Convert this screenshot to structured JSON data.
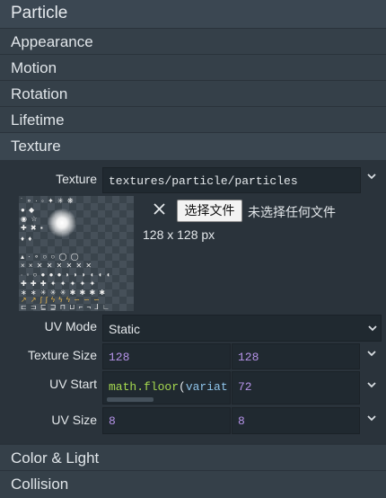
{
  "panel": {
    "title": "Particle"
  },
  "sections": {
    "appearance": "Appearance",
    "motion": "Motion",
    "rotation": "Rotation",
    "lifetime": "Lifetime",
    "texture": "Texture",
    "color_light": "Color & Light",
    "collision": "Collision"
  },
  "texture": {
    "label": "Texture",
    "path": "textures/particle/particles",
    "file_button": "选择文件",
    "no_file": "未选择任何文件",
    "dimensions": "128 x 128 px",
    "close_glyph": "✕"
  },
  "uv_mode": {
    "label": "UV Mode",
    "value": "Static"
  },
  "texture_size": {
    "label": "Texture Size",
    "x": "128",
    "y": "128"
  },
  "uv_start": {
    "label": "UV Start",
    "x_func": "math.floor",
    "x_paren": "(",
    "x_arg": "variat",
    "y": "72"
  },
  "uv_size": {
    "label": "UV Size",
    "x": "8",
    "y": "8"
  },
  "colors": {
    "accent_number": "#b593e8",
    "code_function": "#a6d94f",
    "code_variable": "#8fc4ea"
  }
}
